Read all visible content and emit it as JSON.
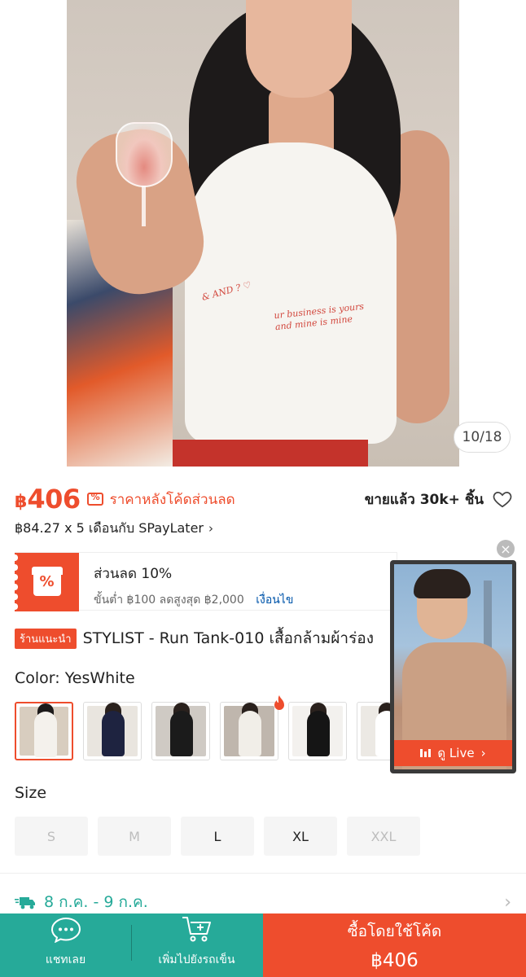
{
  "gallery": {
    "counter": "10/18",
    "shirt_print_main": "ur business is yours and mine is mine",
    "shirt_print_side": "& AND ? ♡"
  },
  "price": {
    "currency": "฿",
    "value": "406",
    "note": "ราคาหลังโค้ดส่วนลด",
    "sold": "ขายแล้ว 30k+ ชิ้น"
  },
  "paylater": {
    "text": "฿84.27 x 5 เดือนกับ SPayLater"
  },
  "voucher": {
    "title": "ส่วนลด 10%",
    "details": "ขั้นต่ำ ฿100 ลดสูงสุด ฿2,000",
    "link": "เงื่อนไข"
  },
  "product": {
    "badge": "ร้านแนะนำ",
    "title": "STYLIST - Run Tank-010 เสื้อกล้ามผ้าร่อง"
  },
  "color": {
    "label": "Color: YesWhite",
    "swatches": [
      "white-tank",
      "navy-tank",
      "black-tank-bag",
      "white-tank-bag",
      "black-tank-2",
      "white-tank-2"
    ]
  },
  "live": {
    "button_label": "ดู Live"
  },
  "size": {
    "label": "Size",
    "options": [
      "S",
      "M",
      "L",
      "XL",
      "XXL"
    ]
  },
  "shipping": {
    "date": "8 ก.ค. - 9 ก.ค."
  },
  "bottom_bar": {
    "chat_label": "แชทเลย",
    "cart_label": "เพิ่มไปยังรถเข็น",
    "buy_label": "ซื้อโดยใช้โค้ด",
    "buy_price": "฿406"
  },
  "colors": {
    "accent": "#ee4d2d",
    "green": "#26aa99",
    "link": "#0055aa"
  }
}
